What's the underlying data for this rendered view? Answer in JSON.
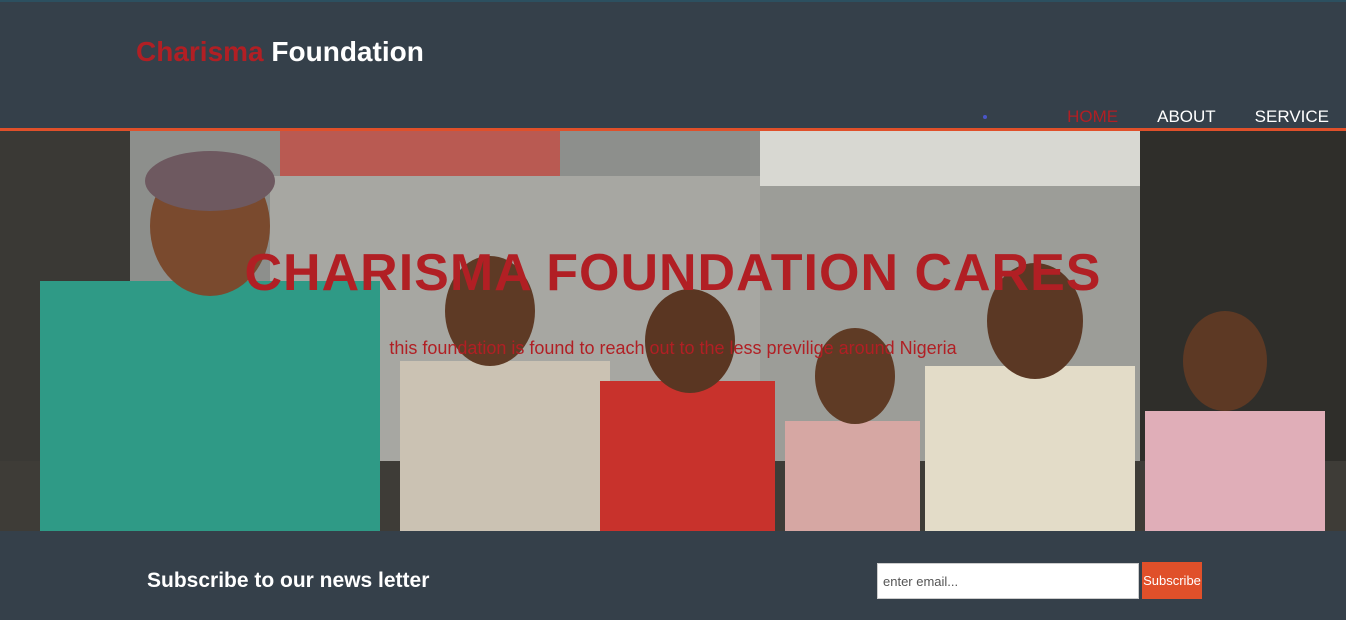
{
  "brand": {
    "part1": "Charisma",
    "part2": "Foundation"
  },
  "nav": {
    "items": [
      {
        "label": "HOME",
        "active": true
      },
      {
        "label": "ABOUT",
        "active": false
      },
      {
        "label": "SERVICE",
        "active": false
      }
    ]
  },
  "hero": {
    "title": "CHARISMA FOUNDATION CARES",
    "subtitle": "this foundation is found to reach out to the less previlige around Nigeria"
  },
  "newsletter": {
    "heading": "Subscribe to our news letter",
    "email_placeholder": "enter email...",
    "button_label": "Subscribe"
  },
  "colors": {
    "background": "#35404a",
    "accent_red": "#b11f24",
    "accent_orange": "#e0502a",
    "text_white": "#ffffff"
  }
}
